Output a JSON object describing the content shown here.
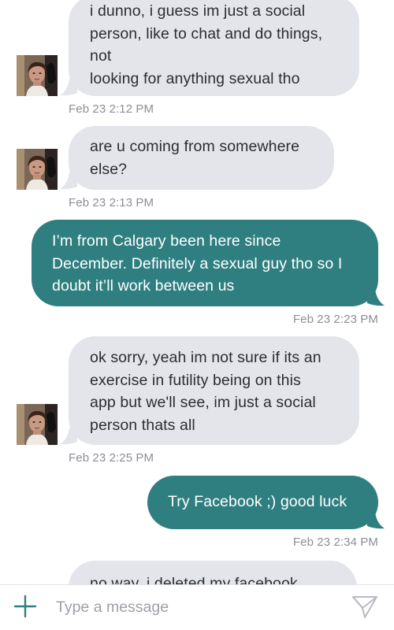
{
  "thread": {
    "messages": [
      {
        "direction": "received",
        "text": "i dunno, i guess im just a social\nperson, like to chat and do things,\nnot\nlooking for anything sexual tho",
        "timestamp": "Feb 23 2:12 PM",
        "avatar": "contact-photo"
      },
      {
        "direction": "received",
        "text": "are u coming from somewhere\nelse?",
        "timestamp": "Feb 23 2:13 PM",
        "avatar": "contact-photo"
      },
      {
        "direction": "sent",
        "text": "I’m from Calgary been here since\nDecember. Definitely a sexual guy tho so I\ndoubt it’ll work between us",
        "timestamp": "Feb 23 2:23 PM"
      },
      {
        "direction": "received",
        "text": "ok sorry, yeah im not sure if its an\nexercise in futility being on this\napp but we'll see, im just a social\nperson thats all",
        "timestamp": "Feb 23 2:25 PM",
        "avatar": "contact-photo"
      },
      {
        "direction": "sent",
        "text": "Try Facebook ;) good luck",
        "timestamp": "Feb 23 2:34 PM"
      },
      {
        "direction": "received",
        "text": "no way, i deleted my facebook",
        "timestamp": ""
      }
    ]
  },
  "composer": {
    "placeholder": "Type a message",
    "value": "",
    "add_icon": "plus-icon",
    "send_icon": "paper-plane-send-icon"
  },
  "colors": {
    "received_bubble": "#e3e5ea",
    "sent_bubble": "#2f7f81",
    "timestamp": "#8c8e96",
    "accent": "#2f7f81",
    "placeholder": "#9ea0a7"
  }
}
